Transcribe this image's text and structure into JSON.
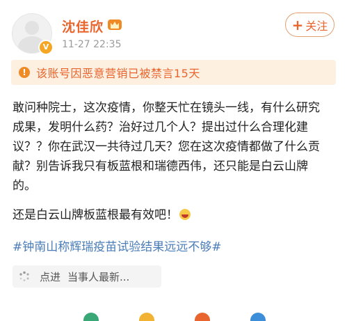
{
  "post": {
    "user": {
      "name": "沈佳欣",
      "avatar_badge": "V"
    },
    "timestamp": "11-27 22:35",
    "follow_label": "关注",
    "follow_plus": "+",
    "notice": {
      "icon": "!",
      "text": "该账号因恶意营销已被禁言15天"
    },
    "body_lines": [
      "敢问种院士，这次疫情，你整天忙在镜头一线，有什么研究",
      "成果，发明什么药？治好过几个人？提出过什么合理化建",
      "议？？你在武汉一共待过几天？您在这次疫情都做了什么贡",
      "献？别告诉我只有板蓝根和瑞德西伟，还只能是白云山牌",
      "的。"
    ],
    "paragraph2": "还是白云山牌板蓝根最有效吧！",
    "hashtag": "#钟南山称辉瑞疫苗试验结果远远不够#",
    "poi": {
      "prefix": "点进",
      "title": "当事人最新..."
    }
  },
  "colors": {
    "accent": "#e8652e",
    "notice_bg": "#fdf0e1",
    "hashtag": "#4a7cb8"
  },
  "icons": {
    "crown": "crown-icon",
    "notice": "warning-icon",
    "poi": "loading-spinner-icon",
    "emoji": "laughing-emoji-icon"
  }
}
